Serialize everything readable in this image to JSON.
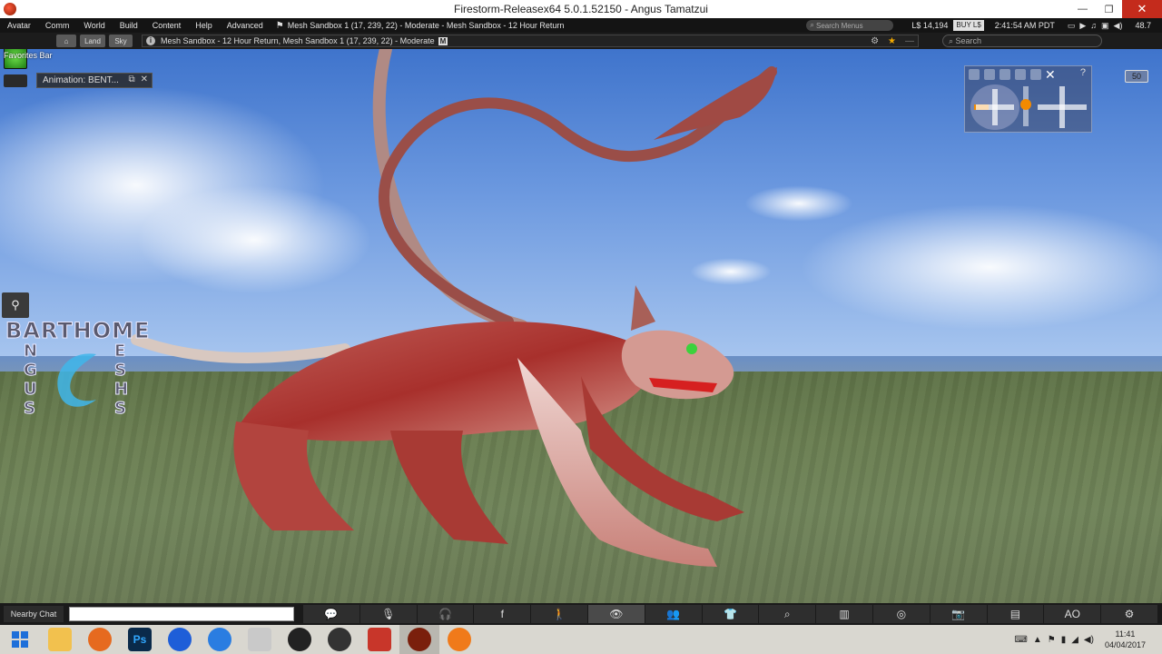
{
  "window": {
    "title": "Firestorm-Releasex64 5.0.1.52150 - Angus Tamatzui",
    "minimize": "—",
    "maximize": "❐",
    "close": "✕"
  },
  "menubar": {
    "items": [
      "Avatar",
      "Comm",
      "World",
      "Build",
      "Content",
      "Help",
      "Advanced"
    ],
    "location": "Mesh Sandbox 1 (17, 239, 22) - Moderate - Mesh Sandbox - 12 Hour Return",
    "search_placeholder": "Search Menus",
    "balance": "L$ 14,194",
    "buy": "BUY L$",
    "time": "2:41:54 AM PDT",
    "fps": "48.7"
  },
  "navbar": {
    "land": "Land",
    "sky": "Sky",
    "location": "Mesh Sandbox - 12 Hour Return, Mesh Sandbox 1 (17, 239, 22) - Moderate",
    "maturity_badge": "M",
    "search_placeholder": "Search"
  },
  "viewport": {
    "favorites_bar": "Favorites Bar",
    "animation_floater": "Animation: BENT...",
    "fps_badge": "50",
    "logo": {
      "line1": "BARTHOME",
      "left_col": "NGUS",
      "right_col": "ESHS"
    }
  },
  "bottombar": {
    "nearby_chat": "Nearby Chat",
    "ao_label": "AO"
  },
  "taskbar": {
    "time": "11:41",
    "date": "04/04/2017"
  },
  "colors": {
    "accent_orange": "#f28a00",
    "close_red": "#c42b1c",
    "creature_red": "#b5403c"
  }
}
